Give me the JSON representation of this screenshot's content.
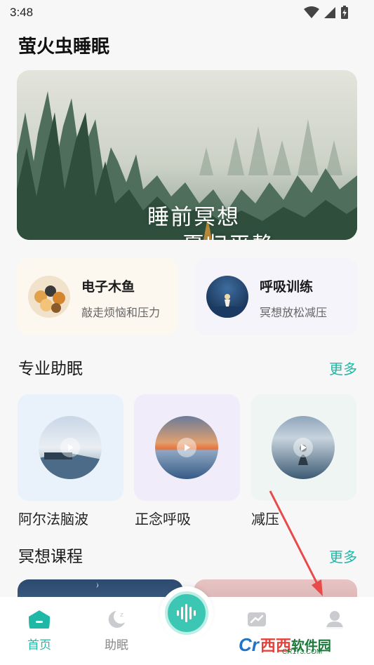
{
  "status_bar": {
    "time": "3:48"
  },
  "header": {
    "title": "萤火虫睡眠"
  },
  "banner": {
    "line1": "睡前冥想",
    "line2": "夏归平静"
  },
  "quick_cards": [
    {
      "title": "电子木鱼",
      "subtitle": "敲走烦恼和压力"
    },
    {
      "title": "呼吸训练",
      "subtitle": "冥想放松减压"
    }
  ],
  "pro_sleep": {
    "title": "专业助眠",
    "more": "更多",
    "items": [
      {
        "label": "阿尔法脑波"
      },
      {
        "label": "正念呼吸"
      },
      {
        "label": "减压"
      }
    ]
  },
  "meditation": {
    "title": "冥想课程",
    "more": "更多"
  },
  "tab_bar": {
    "tabs": [
      {
        "label": "首页",
        "icon": "home-icon"
      },
      {
        "label": "助眠",
        "icon": "moon-icon"
      },
      {
        "label": "",
        "icon": "soundwave-icon"
      },
      {
        "label": "",
        "icon": "chart-icon"
      },
      {
        "label": "",
        "icon": "profile-icon"
      }
    ]
  },
  "watermark": {
    "logo": "Cr",
    "brand": "西西",
    "soft": "软件园",
    "url": "CR173.COM"
  },
  "colors": {
    "accent": "#1fb8a7",
    "background": "#f7f7f8",
    "arrow": "#e84a4a"
  }
}
